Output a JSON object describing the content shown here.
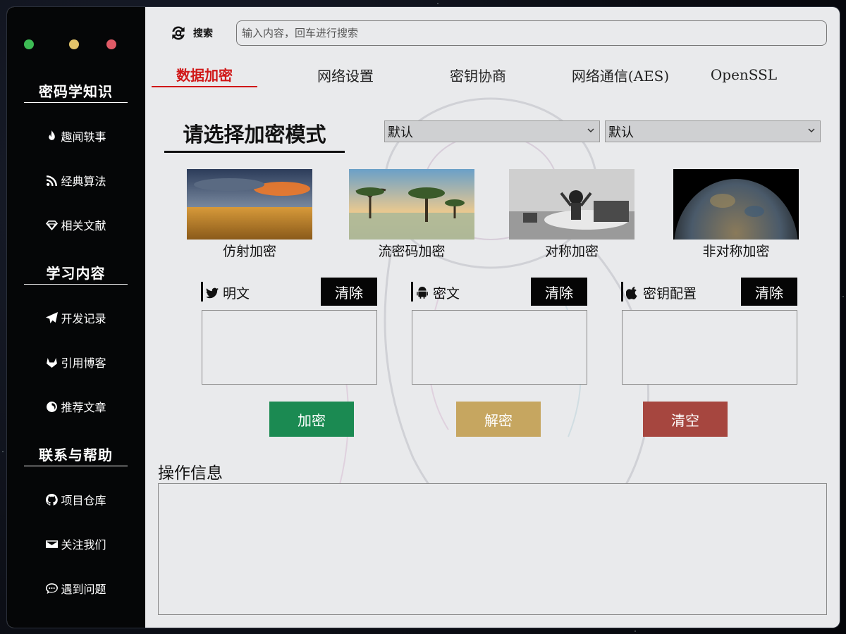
{
  "sidebar": {
    "sections": [
      {
        "title": "密码学知识",
        "items": [
          {
            "label": "趣闻轶事",
            "icon": "fire-icon"
          },
          {
            "label": "经典算法",
            "icon": "rss-icon"
          },
          {
            "label": "相关文献",
            "icon": "diamond-icon"
          }
        ]
      },
      {
        "title": "学习内容",
        "items": [
          {
            "label": "开发记录",
            "icon": "paper-plane-icon"
          },
          {
            "label": "引用博客",
            "icon": "gitlab-icon"
          },
          {
            "label": "推荐文章",
            "icon": "firefox-icon"
          }
        ]
      },
      {
        "title": "联系与帮助",
        "items": [
          {
            "label": "项目仓库",
            "icon": "github-icon"
          },
          {
            "label": "关注我们",
            "icon": "envelope-icon"
          },
          {
            "label": "遇到问题",
            "icon": "comment-icon"
          }
        ]
      }
    ]
  },
  "search": {
    "button_label": "搜索",
    "placeholder": "输入内容，回车进行搜索"
  },
  "tabs": [
    {
      "label": "数据加密",
      "active": true
    },
    {
      "label": "网络设置"
    },
    {
      "label": "密钥协商"
    },
    {
      "label": "网络通信(AES)"
    },
    {
      "label": "OpenSSL"
    }
  ],
  "mode": {
    "title": "请选择加密模式",
    "select_1": "默认",
    "select_2": "默认"
  },
  "cards": [
    {
      "caption": "仿射加密"
    },
    {
      "caption": "流密码加密"
    },
    {
      "caption": "对称加密"
    },
    {
      "caption": "非对称加密"
    }
  ],
  "panels": [
    {
      "label": "明文",
      "clear": "清除",
      "icon": "twitter-icon"
    },
    {
      "label": "密文",
      "clear": "清除",
      "icon": "android-icon"
    },
    {
      "label": "密钥配置",
      "clear": "清除",
      "icon": "apple-icon"
    }
  ],
  "actions": {
    "encrypt": "加密",
    "decrypt": "解密",
    "clear_all": "清空"
  },
  "log": {
    "title": "操作信息"
  },
  "colors": {
    "sidebar": "#050607",
    "active_tab": "#d01818",
    "encrypt": "#1b8a52",
    "decrypt": "#c6a660",
    "clear_all": "#a6463f"
  }
}
